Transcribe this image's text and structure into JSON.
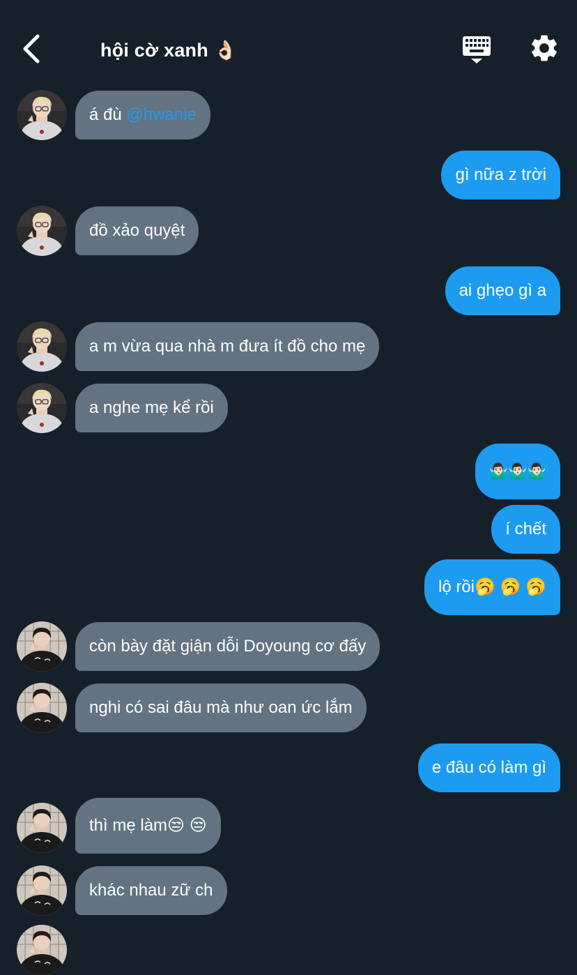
{
  "header": {
    "title": "hội cờ xanh 👌🏻",
    "back_icon": "chevron-left-icon",
    "keyboard_icon": "keyboard-icon",
    "settings_icon": "gear-icon"
  },
  "colors": {
    "background": "#15202b",
    "incoming_bubble": "#637381",
    "outgoing_bubble": "#1d9bf0",
    "mention": "#1d9bf0"
  },
  "messages": [
    {
      "side": "in",
      "sender": "user-a",
      "text": "á đù ",
      "mention": "@hwanie"
    },
    {
      "side": "out",
      "text": "gì nữa z trời"
    },
    {
      "side": "in",
      "sender": "user-a",
      "text": "đồ xảo quyệt"
    },
    {
      "side": "out",
      "text": "ai ghẹo gì a"
    },
    {
      "side": "in",
      "sender": "user-a",
      "text": "a m vừa qua nhà m đưa ít đồ cho mẹ"
    },
    {
      "side": "in",
      "sender": "user-a",
      "text": "a nghe mẹ kể rồi"
    },
    {
      "side": "out",
      "text": "🤷🏻‍♂️🤷🏻‍♂️🤷🏻‍♂️"
    },
    {
      "side": "out",
      "text": "í chết"
    },
    {
      "side": "out",
      "text": "lộ rồi🥱 🥱 🥱"
    },
    {
      "side": "in",
      "sender": "user-b",
      "text": "còn bày đặt giận dỗi Doyoung cơ đấy"
    },
    {
      "side": "in",
      "sender": "user-b",
      "text": "nghi có sai đâu mà như oan ức lắm"
    },
    {
      "side": "out",
      "text": "e đâu có làm gì"
    },
    {
      "side": "in",
      "sender": "user-b",
      "text": "thì mẹ làm😒 😒"
    },
    {
      "side": "in",
      "sender": "user-b",
      "text": "khác nhau zữ ch"
    }
  ]
}
